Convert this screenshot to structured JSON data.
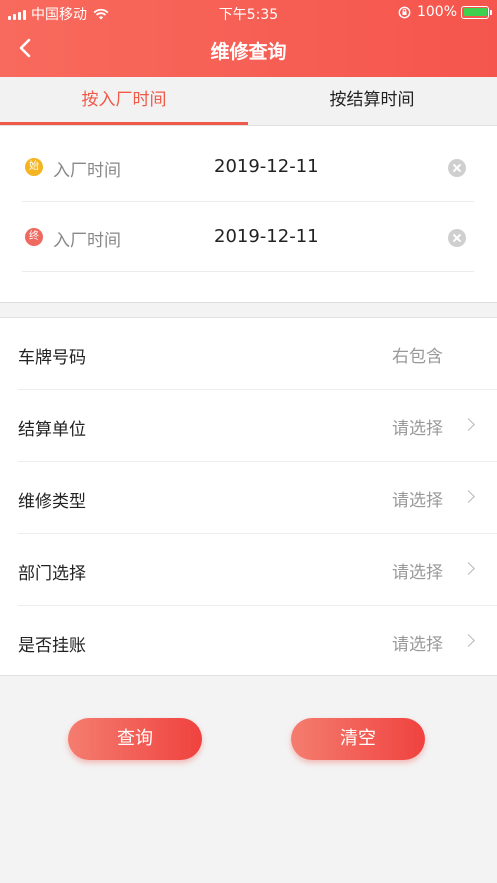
{
  "status_bar": {
    "carrier": "中国移动",
    "time": "下午5:35",
    "battery": "100%"
  },
  "nav": {
    "title": "维修查询",
    "back_icon": "chevron-left-icon"
  },
  "tabs": [
    {
      "label": "按入厂时间",
      "active": true
    },
    {
      "label": "按结算时间",
      "active": false
    }
  ],
  "date_range": {
    "start": {
      "badge": "始",
      "label": "入厂时间",
      "value": "2019-12-11"
    },
    "end": {
      "badge": "终",
      "label": "入厂时间",
      "value": "2019-12-11"
    }
  },
  "form": [
    {
      "label": "车牌号码",
      "value": "右包含",
      "has_arrow": false
    },
    {
      "label": "结算单位",
      "value": "请选择",
      "has_arrow": true
    },
    {
      "label": "维修类型",
      "value": "请选择",
      "has_arrow": true
    },
    {
      "label": "部门选择",
      "value": "请选择",
      "has_arrow": true
    },
    {
      "label": "是否挂账",
      "value": "请选择",
      "has_arrow": true
    }
  ],
  "actions": {
    "query_label": "查询",
    "clear_label": "清空"
  },
  "colors": {
    "accent": "#f05a4a",
    "start_badge": "#f5b422",
    "end_badge": "#ee6a60"
  }
}
